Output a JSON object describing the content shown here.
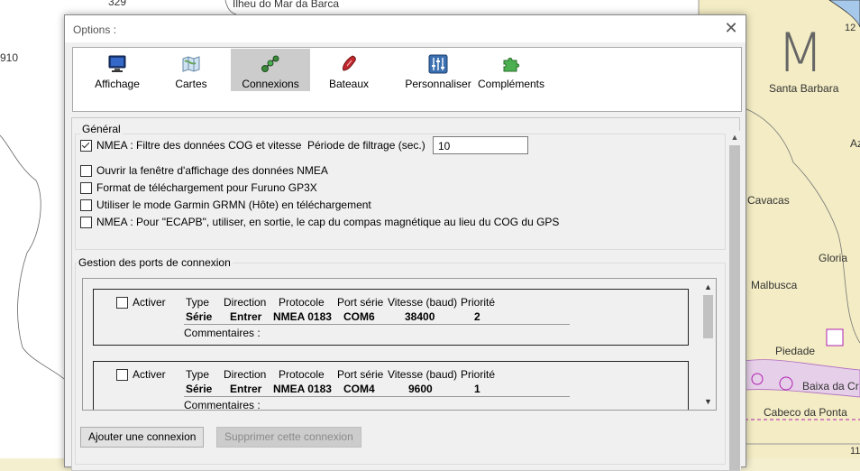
{
  "map": {
    "labels": {
      "top_number": "329",
      "top_place": "Ilheu do Mar da Barca",
      "left_number": "910",
      "big_letters": "M",
      "santa_barbara": "Santa Barbara",
      "az": "Az",
      "number_12": "12",
      "cavacas": "Cavacas",
      "gloria": "Gloria",
      "malbusca": "Malbusca",
      "piedade": "Piedade",
      "baixa": "Baixa da Cr",
      "cabeco": "Cabeco da Ponta",
      "bottom_number": "11"
    }
  },
  "dialog": {
    "title": "Options :",
    "close_glyph": "✕",
    "toolbar": [
      {
        "label": "Affichage",
        "icon": "monitor-icon"
      },
      {
        "label": "Cartes",
        "icon": "maps-icon"
      },
      {
        "label": "Connexions",
        "icon": "connections-icon",
        "selected": true
      },
      {
        "label": "Bateaux",
        "icon": "boat-icon"
      },
      {
        "label": "Personnaliser",
        "icon": "sliders-icon"
      },
      {
        "label": "Compléments",
        "icon": "puzzle-icon"
      }
    ],
    "general": {
      "label": "Général",
      "nmea_filter": {
        "label": "NMEA : Filtre des données COG et vitesse",
        "checked": true
      },
      "filter_period_label": "Période de filtrage (sec.)",
      "filter_period_value": "10",
      "options": [
        {
          "label": "Ouvrir la fenêtre d'affichage des données NMEA",
          "checked": false
        },
        {
          "label": "Format de téléchargement pour Furuno GP3X",
          "checked": false
        },
        {
          "label": "Utiliser le mode Garmin GRMN (Hôte) en téléchargement",
          "checked": false
        },
        {
          "label": "NMEA : Pour \"ECAPB\", utiliser, en sortie, le cap du compas magnétique  au lieu du COG du GPS",
          "checked": false
        }
      ]
    },
    "ports": {
      "label": "Gestion des ports de connexion",
      "headers": {
        "activate": "Activer",
        "type": "Type",
        "direction": "Direction",
        "protocol": "Protocole",
        "serial_port": "Port série",
        "speed": "Vitesse (baud)",
        "priority": "Priorité",
        "comments": "Commentaires :"
      },
      "connections": [
        {
          "type": "Série",
          "direction": "Entrer",
          "protocol": "NMEA 0183",
          "port": "COM6",
          "speed": "38400",
          "priority": "2",
          "active": false
        },
        {
          "type": "Série",
          "direction": "Entrer",
          "protocol": "NMEA 0183",
          "port": "COM4",
          "speed": "9600",
          "priority": "1",
          "active": false
        }
      ]
    },
    "buttons": {
      "add": "Ajouter une connexion",
      "remove": "Supprimer cette connexion"
    }
  }
}
